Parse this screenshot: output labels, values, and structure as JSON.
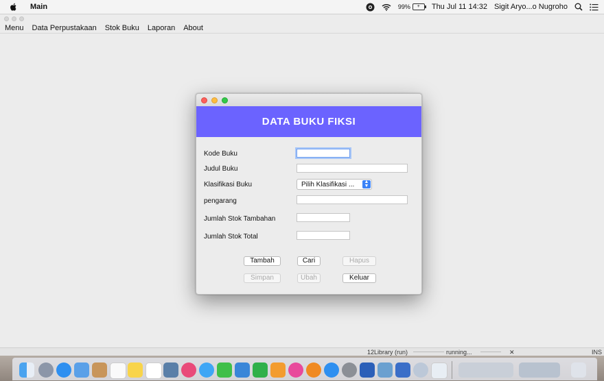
{
  "menubar": {
    "app_name": "Main",
    "battery_percent": "99%",
    "battery_glyph": "+",
    "datetime": "Thu Jul 11 14:32",
    "user_name": "Sigit Aryo...o Nugroho",
    "icons": [
      "apple-icon",
      "screen-recorder-icon",
      "wifi-icon",
      "battery-icon",
      "spotlight-icon",
      "notification-center-icon"
    ]
  },
  "app_menu": {
    "items": [
      "Menu",
      "Data Perpustakaan",
      "Stok Buku",
      "Laporan",
      "About"
    ]
  },
  "dialog": {
    "title": "DATA BUKU FIKSI",
    "header_color": "#6b63ff",
    "labels": {
      "kode_buku": "Kode Buku",
      "judul_buku": "Judul Buku",
      "klasifikasi_buku": "Klasifikasi Buku",
      "pengarang": "pengarang",
      "jumlah_stok_tambahan": "Jumlah Stok Tambahan",
      "jumlah_stok_total": "Jumlah Stok Total"
    },
    "values": {
      "kode_buku": "",
      "judul_buku": "",
      "pengarang": "",
      "jumlah_stok_tambahan": "",
      "jumlah_stok_total": ""
    },
    "klasifikasi_selected": "Pilih Klasifikasi ...",
    "buttons": {
      "tambah": "Tambah",
      "cari": "Cari",
      "hapus": "Hapus",
      "simpan": "Simpan",
      "ubah": "Ubah",
      "keluar": "Keluar"
    }
  },
  "status": {
    "project": "12Library (run)",
    "state": "running...",
    "close_glyph": "✕",
    "mode": "INS"
  },
  "dock": {
    "icons": [
      "finder-icon",
      "launchpad-icon",
      "safari-icon",
      "mail-icon",
      "contacts-icon",
      "calendar-icon",
      "notes-icon",
      "reminders-icon",
      "photos-icon",
      "photo-booth-icon",
      "messages-icon",
      "facetime-icon",
      "keynote-icon",
      "numbers-icon",
      "pages-icon",
      "itunes-icon",
      "ibooks-icon",
      "app-store-icon",
      "system-preferences-icon",
      "word-icon",
      "preview-icon",
      "virtualbox-icon",
      "netbeans-icon",
      "java-icon",
      "downloads-icon",
      "documents-icon",
      "trash-icon"
    ]
  }
}
